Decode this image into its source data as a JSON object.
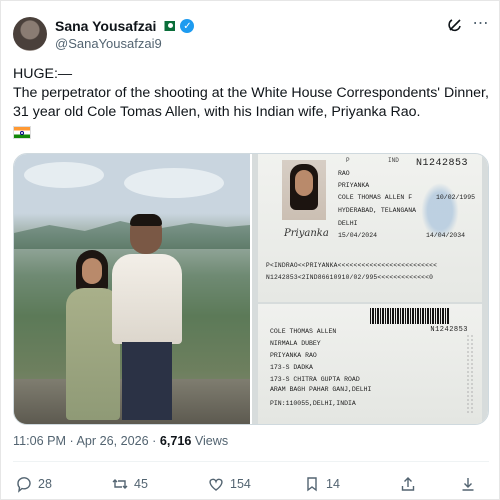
{
  "user": {
    "name": "Sana Yousafzai",
    "handle": "@SanaYousafzai9"
  },
  "tweet": {
    "lines": [
      "HUGE:—",
      "The perpetrator of the shooting at the White House Correspondents' Dinner, 31 year old Cole Tomas Allen, with his Indian wife, Priyanka Rao."
    ]
  },
  "passport": {
    "top_code": "P",
    "country": "IND",
    "number": "N1242853",
    "number2": "N1242853",
    "surname": "RAO",
    "given_name": "PRIYANKA",
    "spouse_field": "COLE THOMAS ALLEN F",
    "dob": "10/02/1995",
    "place": "HYDERABAD, TELANGANA",
    "issue_place": "DELHI",
    "issue_date": "15/04/2024",
    "expiry": "14/04/2034",
    "signature": "Priyanka",
    "mrz1": "P<INDRAO<<PRIYANKA<<<<<<<<<<<<<<<<<<<<<<<<<",
    "mrz2": "N1242853<2IND86610910/02/995<<<<<<<<<<<<<0",
    "father": "COLE THOMAS ALLEN",
    "mother": "NIRMALA DUBEY",
    "spouse": "PRIYANKA RAO",
    "addr1": "173-S DADKA",
    "addr2": "173-S CHITRA GUPTA ROAD",
    "addr3": "ARAM BAGH PAHAR GANJ,DELHI",
    "pin": "PIN:110055,DELHI,INDIA"
  },
  "meta": {
    "time": "11:06 PM",
    "date": "Apr 26, 2026",
    "views_count": "6,716",
    "views_label": "Views"
  },
  "actions": {
    "replies": "28",
    "reposts": "45",
    "likes": "154",
    "bookmarks": "14"
  }
}
